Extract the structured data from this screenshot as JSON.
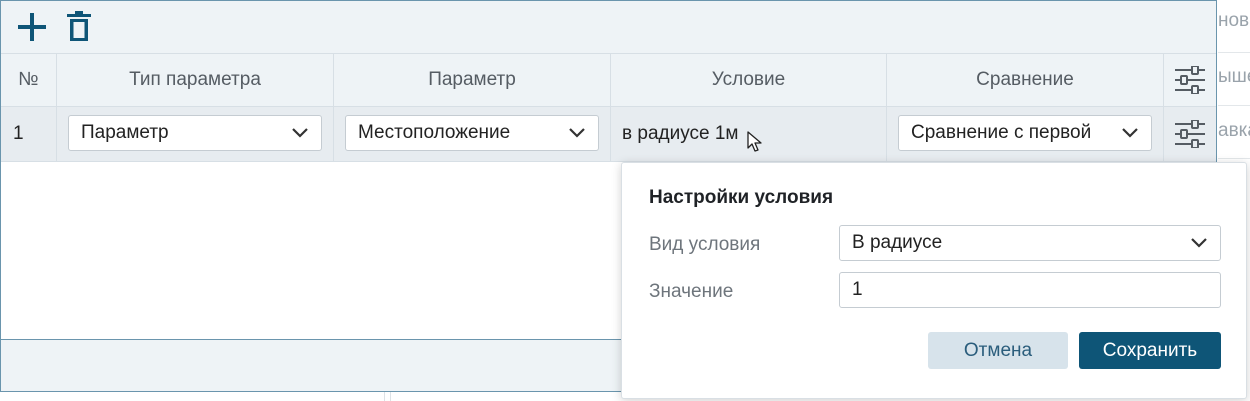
{
  "toolbar": {
    "add_icon": "plus-icon",
    "delete_icon": "trash-icon"
  },
  "table": {
    "headers": [
      "№",
      "Тип параметра",
      "Параметр",
      "Условие",
      "Сравнение"
    ],
    "settings_icon": "sliders-icon",
    "rows": [
      {
        "index": "1",
        "param_type": "Параметр",
        "param": "Местоположение",
        "condition": "в радиусе 1м",
        "comparison": "Сравнение с первой"
      }
    ]
  },
  "background": {
    "right_texts": [
      "нов",
      "ыше",
      "авка"
    ]
  },
  "popup": {
    "title": "Настройки условия",
    "condition_type_label": "Вид условия",
    "condition_type_value": "В радиусе",
    "value_label": "Значение",
    "value": "1",
    "cancel_label": "Отмена",
    "save_label": "Сохранить"
  },
  "colors": {
    "accent": "#0e5577",
    "cancel_bg": "#d7e3eb",
    "panel_bg": "#eef3f6",
    "border": "#6a95ad"
  }
}
